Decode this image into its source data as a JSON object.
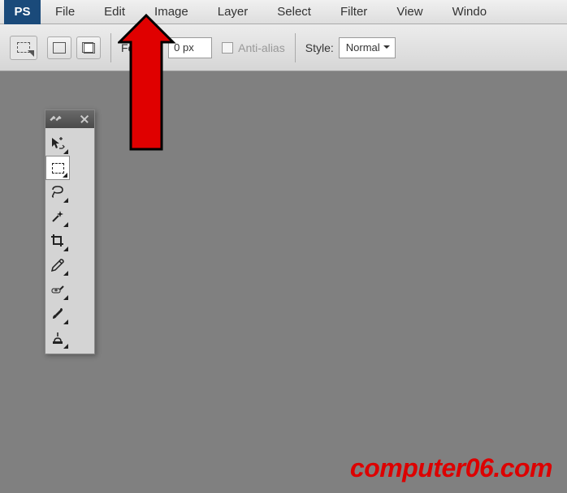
{
  "app": {
    "logo": "PS"
  },
  "menus": [
    "File",
    "Edit",
    "Image",
    "Layer",
    "Select",
    "Filter",
    "View",
    "Windo"
  ],
  "options": {
    "feather_label": "Feather:",
    "feather_value": "0 px",
    "anti_alias": "Anti-alias",
    "style_label": "Style:",
    "style_value": "Normal"
  },
  "tool_names": [
    "move-tool",
    "marquee-tool",
    "lasso-tool",
    "magic-wand-tool",
    "crop-tool",
    "eyedropper-tool",
    "healing-brush-tool",
    "brush-tool",
    "clone-stamp-tool"
  ],
  "watermark": "computer06.com"
}
